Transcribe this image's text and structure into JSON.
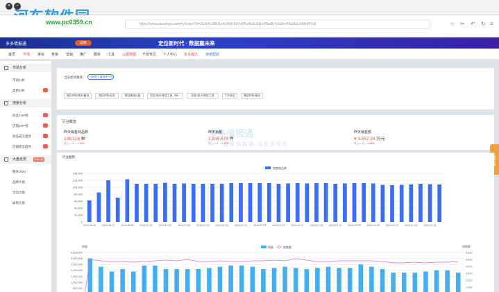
{
  "browser": {
    "watermark_text": "河东软件园",
    "watermark_url": "www.pc0359.cn",
    "url": "https://www.duoshuju.com/hy/index?id=2b3e5c2f8d1e4a3b9c0d7e6f5a4b3c2d1e0f9a8b7c6d5e4f3a2b1c0d9e8f7a6"
  },
  "banner": {
    "logo_label": "多多情报通",
    "pill_label": "续费",
    "slogan": "定位新时代 · 数据赢未来"
  },
  "topnav": {
    "items": [
      {
        "label": "首页"
      },
      {
        "label": "市场"
      },
      {
        "label": "排名"
      },
      {
        "label": "竞争"
      },
      {
        "label": "营销"
      },
      {
        "label": "推广"
      },
      {
        "label": "服务"
      },
      {
        "label": "工具"
      },
      {
        "label": "以图搜图"
      },
      {
        "label": "千款专区"
      },
      {
        "label": "个人中心"
      },
      {
        "label": "多多直达"
      },
      {
        "label": "使用帮助"
      }
    ]
  },
  "sidebar": {
    "sections": [
      {
        "title": "市场分析",
        "items": [
          {
            "label": "市场分析"
          },
          {
            "label": "类目分析"
          }
        ]
      },
      {
        "title": "搜索分析",
        "items": [
          {
            "label": "商品TOP榜"
          },
          {
            "label": "店铺TOP榜"
          },
          {
            "label": "商品成交趋势"
          },
          {
            "label": "店铺成交趋势"
          }
        ]
      },
      {
        "title": "大盘走势",
        "badge": "新版功能",
        "items": [
          {
            "label": "整体GMV"
          },
          {
            "label": "品牌大盘"
          },
          {
            "label": "活动大盘"
          },
          {
            "label": "类目大盘"
          }
        ]
      }
    ]
  },
  "filter": {
    "label": "当前类目路径：",
    "button": "一级类目/请选择下拉",
    "tags": [
      "美容护肤/美体/精油",
      "美容护肤/彩妆",
      "美容美体仪器",
      "彩妆/香水/美妆工具（新）",
      "彩妆/香水/美妆工具",
      "个护清洁",
      "美容护肤/精油"
    ]
  },
  "industry": {
    "title": "行业概览",
    "stats": [
      {
        "label": "昨天销售商品数",
        "value": "108,116",
        "unit": "种",
        "cmp_prefix": "较上一天",
        "cmp": "↑ 2.49%"
      },
      {
        "label": "昨天销量",
        "value": "1,835,678",
        "unit": "件",
        "cmp_prefix": "较上一天",
        "cmp": "↑ 4.75%"
      },
      {
        "label": "昨天销售额",
        "value": "¥ 3,557.24",
        "unit": "万元",
        "cmp_prefix": "较上一天",
        "cmp": "↑ 3.98%"
      }
    ],
    "bg_watermark": "多多情报通",
    "bg_watermark_sub": "选择情报通 运营更轻松"
  },
  "side_tab": "在线客服",
  "trend": {
    "title": "行业趋势"
  },
  "chart_data": [
    {
      "type": "bar",
      "title": "",
      "series": [
        {
          "name": "销售商品数",
          "values": [
            62000,
            85000,
            120000,
            70000,
            123000,
            110000,
            110000,
            110000,
            113000,
            110000,
            111000,
            110000,
            110000,
            110000,
            110000,
            112000,
            112000,
            112000,
            112000,
            112000,
            110000,
            111000,
            112000,
            111000,
            112000,
            112000,
            110000,
            111000,
            112000,
            112000,
            111000,
            107000,
            106000,
            107000,
            108000,
            110000,
            109000,
            108000
          ]
        }
      ],
      "x_ticks": [
        "2019-06-25",
        "2019-06-27",
        "2019-06-29",
        "2019-07-01",
        "2019-07-03",
        "2019-07-05",
        "2019-07-07",
        "2019-07-09",
        "2019-07-11",
        "2019-07-13",
        "2019-07-15",
        "2019-07-17",
        "2019-07-19",
        "2019-07-21",
        "2019-07-23",
        "2019-07-25",
        "2019-07-27",
        "2019-07-29",
        "2019-07-31"
      ],
      "y_ticks": [
        "0",
        "20,000",
        "40,000",
        "60,000",
        "80,000",
        "100,000",
        "120,000",
        "140,000"
      ],
      "ylim": [
        0,
        140000
      ],
      "grid": true,
      "legend": "top-center",
      "colors": {
        "bar": "#3b6ff2"
      }
    },
    {
      "type": "bar",
      "title": "",
      "ylabel_left": "销量",
      "ylabel_right": "销售额",
      "series": [
        {
          "name": "销量",
          "type": "bar",
          "values": [
            3000000,
            2300000,
            1900000,
            2100000,
            1900000,
            2400000,
            2400000,
            2100000,
            2100000,
            2100000,
            2100000,
            2200000,
            2300000,
            2400000,
            2400000,
            2300000,
            2100000,
            2200000,
            2300000,
            2200000,
            2100000,
            2200000,
            2300000,
            2200000,
            2200000,
            2500000,
            2300000,
            2100000,
            1800000,
            1800000,
            1800000,
            1900000,
            2000000,
            2000000,
            1800000
          ]
        },
        {
          "name": "销售额",
          "type": "line",
          "values": [
            5000,
            4800,
            4700,
            4700,
            4600,
            4700,
            4800,
            4900,
            4800,
            5000,
            4700,
            4700,
            4800,
            4700,
            4700,
            4800,
            4800,
            4900,
            4800,
            5100,
            4900,
            4700,
            4700,
            4800,
            4800,
            4800,
            4800,
            4700,
            4500,
            4500,
            4600,
            4500,
            4600,
            4600,
            4700
          ]
        }
      ],
      "y_ticks_left": [
        "0",
        "500,000",
        "1,000,000",
        "1,500,000",
        "2,000,000",
        "2,500,000",
        "3,000,000",
        "3,500,000"
      ],
      "y_ticks_right": [
        "0",
        "1,000",
        "2,000",
        "3,000",
        "4,000",
        "5,000",
        "6,000"
      ],
      "ylim_left": [
        0,
        3500000
      ],
      "ylim_right": [
        0,
        6000
      ],
      "legend": "top-center",
      "colors": {
        "bar": "#45aef2",
        "line": "#d86ad6"
      }
    }
  ]
}
